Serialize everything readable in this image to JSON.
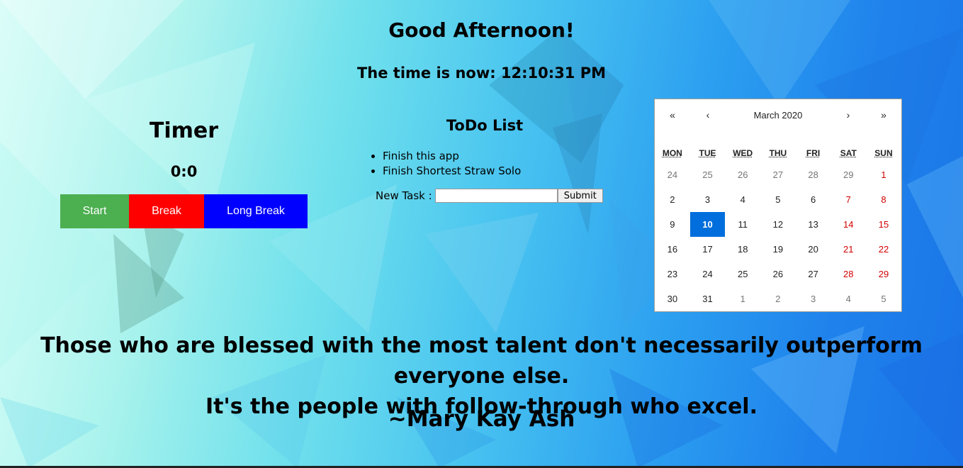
{
  "greeting": "Good Afternoon!",
  "clock": "The time is now: 12:10:31 PM",
  "timer": {
    "title": "Timer",
    "value": "0:0",
    "start_label": "Start",
    "break_label": "Break",
    "long_break_label": "Long Break"
  },
  "todo": {
    "title": "ToDo List",
    "items": [
      "Finish this app",
      "Finish Shortest Straw Solo"
    ],
    "new_task_label": "New Task :",
    "new_task_value": "",
    "submit_label": "Submit"
  },
  "calendar": {
    "month_label": "March 2020",
    "prev_year_label": "«",
    "prev_month_label": "‹",
    "next_month_label": "›",
    "next_year_label": "»",
    "weekdays": [
      "MON",
      "TUE",
      "WED",
      "THU",
      "FRI",
      "SAT",
      "SUN"
    ],
    "weeks": [
      [
        "24",
        "25",
        "26",
        "27",
        "28",
        "29",
        "1"
      ],
      [
        "2",
        "3",
        "4",
        "5",
        "6",
        "7",
        "8"
      ],
      [
        "9",
        "10",
        "11",
        "12",
        "13",
        "14",
        "15"
      ],
      [
        "16",
        "17",
        "18",
        "19",
        "20",
        "21",
        "22"
      ],
      [
        "23",
        "24",
        "25",
        "26",
        "27",
        "28",
        "29"
      ],
      [
        "30",
        "31",
        "1",
        "2",
        "3",
        "4",
        "5"
      ]
    ],
    "selected_day": "10"
  },
  "quote": {
    "line1": "Those who are blessed with the most talent don't necessarily outperform everyone else.",
    "line2": "It's the people with follow-through who excel.",
    "author": "~Mary Kay Ash"
  },
  "colors": {
    "start": "#4caf50",
    "break": "#ff0000",
    "long_break": "#0000ff",
    "selected_day": "#006edc",
    "weekend": "#d10000"
  }
}
